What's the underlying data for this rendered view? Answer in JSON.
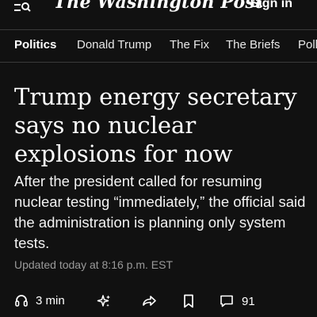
{
  "header": {
    "masthead": "The Washington Post",
    "signin_label": "Sign in",
    "menu_icon": "menu-search-icon"
  },
  "nav": {
    "items": [
      {
        "label": "Politics",
        "active": true
      },
      {
        "label": "Donald Trump",
        "active": false
      },
      {
        "label": "The Fix",
        "active": false
      },
      {
        "label": "The Briefs",
        "active": false
      },
      {
        "label": "Poll",
        "active": false
      }
    ]
  },
  "article": {
    "headline": "Trump energy secretary says no nuclear explosions for now",
    "dek": "After the president called for resuming nuclear testing “immediately,” the official said the administration is planning only system tests.",
    "timestamp": "Updated today at 8:16 p.m. EST"
  },
  "actions": {
    "listen_label": "3 min",
    "comments_count": "91",
    "icons": [
      "headphones-icon",
      "sparkle-icon",
      "share-icon",
      "bookmark-icon",
      "comment-icon"
    ]
  },
  "colors": {
    "background": "#111111",
    "text": "#ffffff",
    "muted": "#9a9a9a",
    "divider": "#3a3a3a"
  }
}
